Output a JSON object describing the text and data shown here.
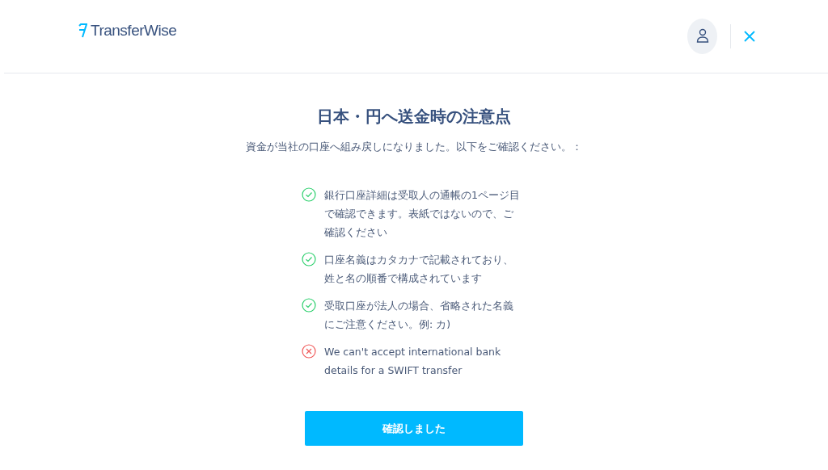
{
  "header": {
    "logo_text": "TransferWise"
  },
  "title": "日本・円へ送金時の注意点",
  "subtitle": "資金が当社の口座へ組み戻しになりました。以下をご確認ください。：",
  "notes": [
    {
      "kind": "ok",
      "lines": [
        "銀行口座詳細は受取人の通帳の1ページ目",
        "で確認できます。表紙ではないので、ご",
        "確認ください"
      ]
    },
    {
      "kind": "ok",
      "lines": [
        "口座名義はカタカナで記載されており、",
        "姓と名の順番で構成されています"
      ]
    },
    {
      "kind": "ok",
      "lines": [
        "受取口座が法人の場合、省略された名義",
        "にご注意ください。例: カ)"
      ]
    },
    {
      "kind": "error",
      "lines": [
        "We can't accept international bank",
        "details for a SWIFT transfer"
      ]
    }
  ],
  "confirm_button": "確認しました"
}
